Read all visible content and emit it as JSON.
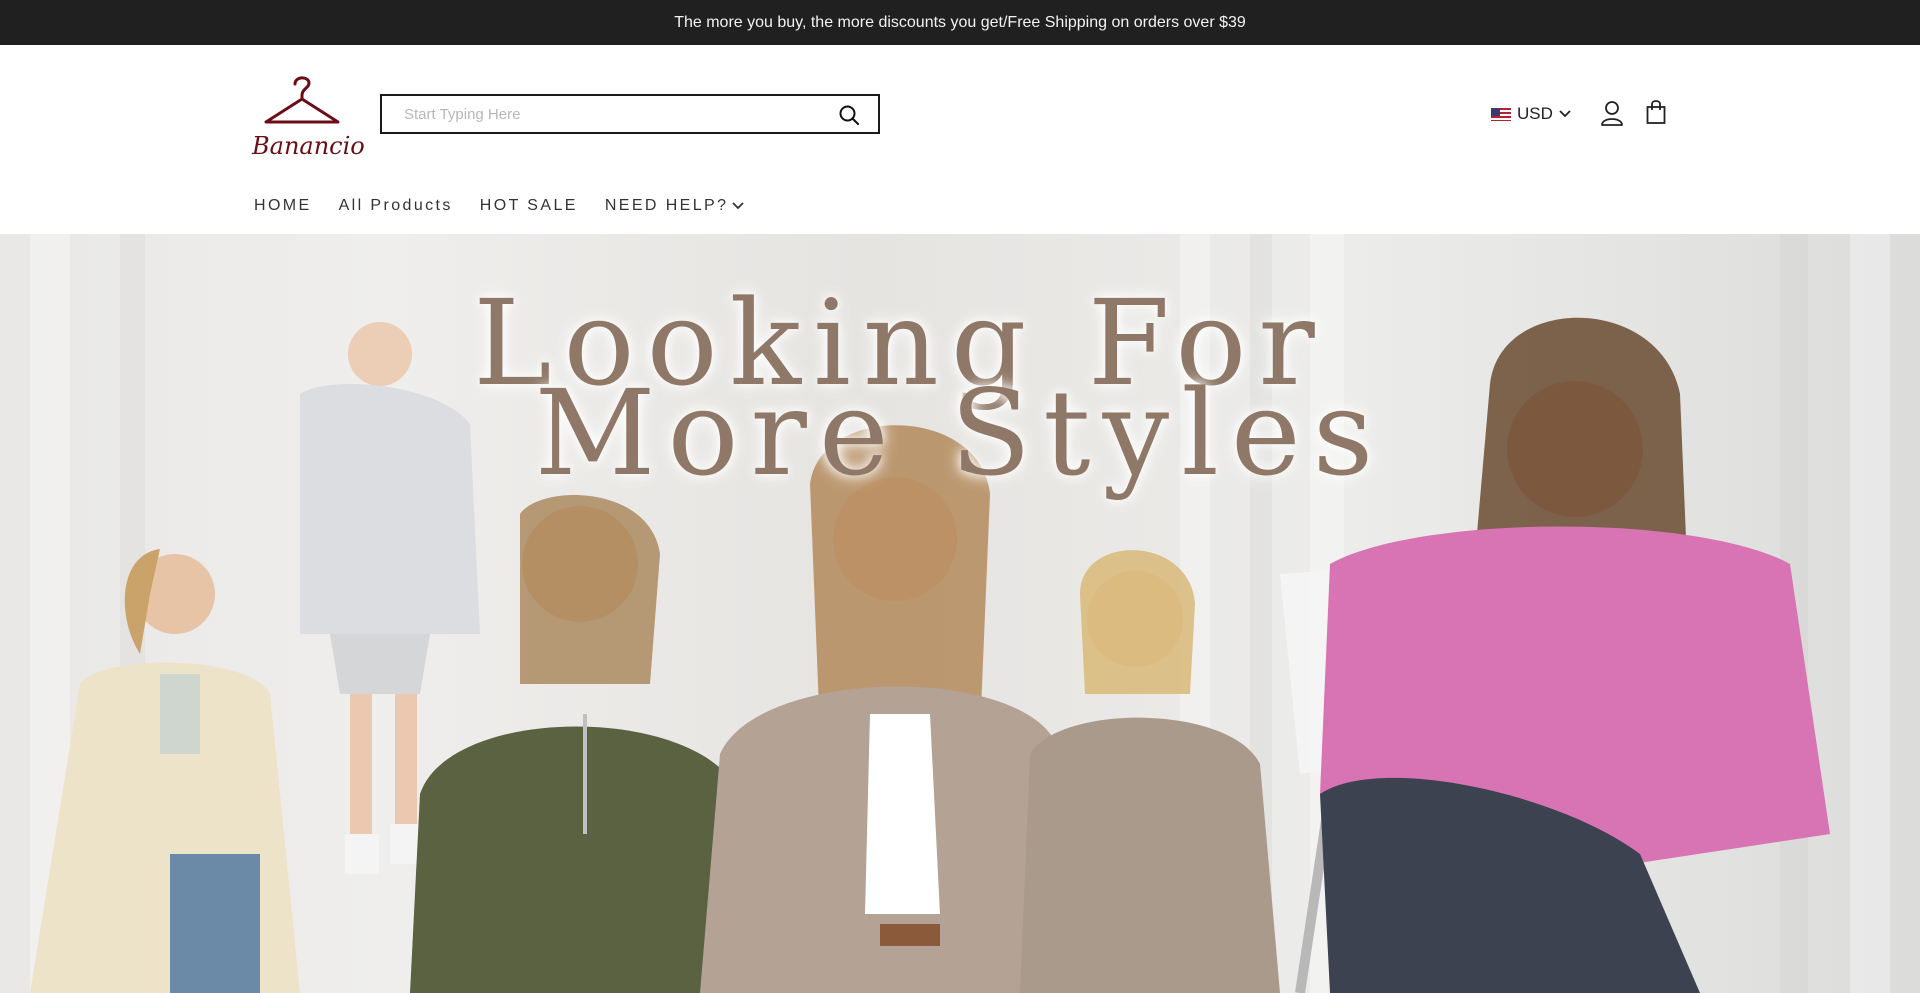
{
  "announcement": "The more you buy, the more discounts you get/Free Shipping on orders over $39",
  "brand": {
    "name": "Banancio",
    "color": "#6b0d16"
  },
  "search": {
    "placeholder": "Start Typing Here",
    "value": "",
    "icon": "search-icon"
  },
  "currency": {
    "selected": "USD",
    "flag": "us-flag-icon"
  },
  "header_icons": [
    "account-icon",
    "shopping-bag-icon"
  ],
  "nav": [
    {
      "label": "HOME"
    },
    {
      "label": "All Products"
    },
    {
      "label": "HOT SALE"
    },
    {
      "label": "NEED HELP?",
      "has_dropdown": true
    }
  ],
  "hero": {
    "line1": "Looking For",
    "line2": "More Styles",
    "text_color": "#8f7867"
  },
  "colors": {
    "announcement_bg": "#202020",
    "text": "#222222"
  }
}
